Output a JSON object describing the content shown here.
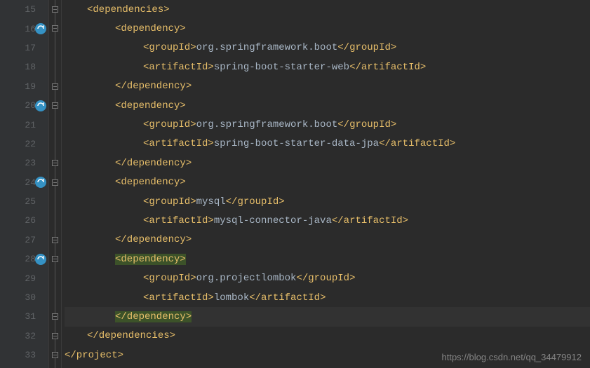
{
  "lines": [
    {
      "num": 15,
      "marker": false,
      "fold": true,
      "indent": 1,
      "segments": [
        {
          "cls": "tag",
          "t": "<dependencies>"
        }
      ]
    },
    {
      "num": 16,
      "marker": true,
      "fold": true,
      "indent": 2,
      "segments": [
        {
          "cls": "tag",
          "t": "<dependency>"
        }
      ]
    },
    {
      "num": 17,
      "marker": false,
      "fold": false,
      "indent": 3,
      "segments": [
        {
          "cls": "tag",
          "t": "<groupId>"
        },
        {
          "cls": "text",
          "t": "org.springframework.boot"
        },
        {
          "cls": "tag",
          "t": "</groupId>"
        }
      ]
    },
    {
      "num": 18,
      "marker": false,
      "fold": false,
      "indent": 3,
      "segments": [
        {
          "cls": "tag",
          "t": "<artifactId>"
        },
        {
          "cls": "text",
          "t": "spring-boot-starter-web"
        },
        {
          "cls": "tag",
          "t": "</artifactId>"
        }
      ]
    },
    {
      "num": 19,
      "marker": false,
      "fold": true,
      "indent": 2,
      "segments": [
        {
          "cls": "tag",
          "t": "</dependency>"
        }
      ]
    },
    {
      "num": 20,
      "marker": true,
      "fold": true,
      "indent": 2,
      "segments": [
        {
          "cls": "tag",
          "t": "<dependency>"
        }
      ]
    },
    {
      "num": 21,
      "marker": false,
      "fold": false,
      "indent": 3,
      "segments": [
        {
          "cls": "tag",
          "t": "<groupId>"
        },
        {
          "cls": "text",
          "t": "org.springframework.boot"
        },
        {
          "cls": "tag",
          "t": "</groupId>"
        }
      ]
    },
    {
      "num": 22,
      "marker": false,
      "fold": false,
      "indent": 3,
      "segments": [
        {
          "cls": "tag",
          "t": "<artifactId>"
        },
        {
          "cls": "text",
          "t": "spring-boot-starter-data-jpa"
        },
        {
          "cls": "tag",
          "t": "</artifactId>"
        }
      ]
    },
    {
      "num": 23,
      "marker": false,
      "fold": true,
      "indent": 2,
      "segments": [
        {
          "cls": "tag",
          "t": "</dependency>"
        }
      ]
    },
    {
      "num": 24,
      "marker": true,
      "fold": true,
      "indent": 2,
      "segments": [
        {
          "cls": "tag",
          "t": "<dependency>"
        }
      ]
    },
    {
      "num": 25,
      "marker": false,
      "fold": false,
      "indent": 3,
      "segments": [
        {
          "cls": "tag",
          "t": "<groupId>"
        },
        {
          "cls": "text",
          "t": "mysql"
        },
        {
          "cls": "tag",
          "t": "</groupId>"
        }
      ]
    },
    {
      "num": 26,
      "marker": false,
      "fold": false,
      "indent": 3,
      "segments": [
        {
          "cls": "tag",
          "t": "<artifactId>"
        },
        {
          "cls": "text",
          "t": "mysql-connector-java"
        },
        {
          "cls": "tag",
          "t": "</artifactId>"
        }
      ]
    },
    {
      "num": 27,
      "marker": false,
      "fold": true,
      "indent": 2,
      "segments": [
        {
          "cls": "tag",
          "t": "</dependency>"
        }
      ]
    },
    {
      "num": 28,
      "marker": true,
      "fold": true,
      "indent": 2,
      "segments": [
        {
          "cls": "hl",
          "t": "<dependency>"
        }
      ]
    },
    {
      "num": 29,
      "marker": false,
      "fold": false,
      "indent": 3,
      "segments": [
        {
          "cls": "tag",
          "t": "<groupId>"
        },
        {
          "cls": "text",
          "t": "org.projectlombok"
        },
        {
          "cls": "tag",
          "t": "</groupId>"
        }
      ]
    },
    {
      "num": 30,
      "marker": false,
      "fold": false,
      "indent": 3,
      "segments": [
        {
          "cls": "tag",
          "t": "<artifactId>"
        },
        {
          "cls": "text",
          "t": "lombok"
        },
        {
          "cls": "tag",
          "t": "</artifactId>"
        }
      ]
    },
    {
      "num": 31,
      "marker": false,
      "fold": true,
      "indent": 2,
      "current": true,
      "segments": [
        {
          "cls": "hl",
          "t": "</dependency>"
        }
      ]
    },
    {
      "num": 32,
      "marker": false,
      "fold": true,
      "indent": 1,
      "segments": [
        {
          "cls": "tag",
          "t": "</dependencies>"
        }
      ]
    },
    {
      "num": 33,
      "marker": false,
      "fold": true,
      "indent": 0,
      "segments": [
        {
          "cls": "tag",
          "t": "</project>"
        }
      ]
    }
  ],
  "watermark": "https://blog.csdn.net/qq_34479912"
}
